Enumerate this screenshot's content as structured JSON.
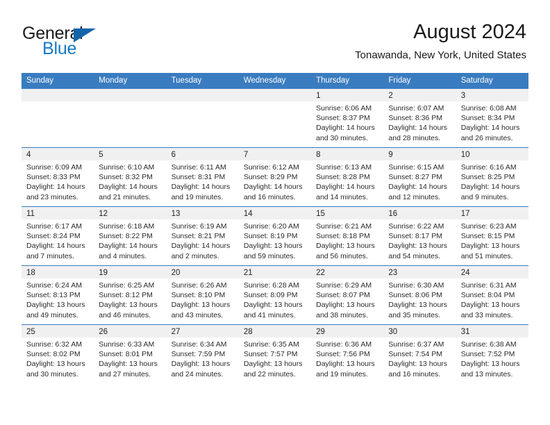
{
  "brand": {
    "line1": "General",
    "line2": "Blue",
    "triangle_color": "#1464aa",
    "blue_color": "#1579c4"
  },
  "header": {
    "title": "August 2024",
    "subtitle": "Tonawanda, New York, United States"
  },
  "theme": {
    "header_blue": "#3a7cc0",
    "daynum_band": "#f0f0f0",
    "text": "#2a2a2a"
  },
  "weekday_headers": [
    "Sunday",
    "Monday",
    "Tuesday",
    "Wednesday",
    "Thursday",
    "Friday",
    "Saturday"
  ],
  "weeks": [
    [
      {
        "day": "",
        "sunrise": "",
        "sunset": "",
        "daylight_line1": "",
        "daylight_line2": ""
      },
      {
        "day": "",
        "sunrise": "",
        "sunset": "",
        "daylight_line1": "",
        "daylight_line2": ""
      },
      {
        "day": "",
        "sunrise": "",
        "sunset": "",
        "daylight_line1": "",
        "daylight_line2": ""
      },
      {
        "day": "",
        "sunrise": "",
        "sunset": "",
        "daylight_line1": "",
        "daylight_line2": ""
      },
      {
        "day": "1",
        "sunrise": "Sunrise: 6:06 AM",
        "sunset": "Sunset: 8:37 PM",
        "daylight_line1": "Daylight: 14 hours",
        "daylight_line2": "and 30 minutes."
      },
      {
        "day": "2",
        "sunrise": "Sunrise: 6:07 AM",
        "sunset": "Sunset: 8:36 PM",
        "daylight_line1": "Daylight: 14 hours",
        "daylight_line2": "and 28 minutes."
      },
      {
        "day": "3",
        "sunrise": "Sunrise: 6:08 AM",
        "sunset": "Sunset: 8:34 PM",
        "daylight_line1": "Daylight: 14 hours",
        "daylight_line2": "and 26 minutes."
      }
    ],
    [
      {
        "day": "4",
        "sunrise": "Sunrise: 6:09 AM",
        "sunset": "Sunset: 8:33 PM",
        "daylight_line1": "Daylight: 14 hours",
        "daylight_line2": "and 23 minutes."
      },
      {
        "day": "5",
        "sunrise": "Sunrise: 6:10 AM",
        "sunset": "Sunset: 8:32 PM",
        "daylight_line1": "Daylight: 14 hours",
        "daylight_line2": "and 21 minutes."
      },
      {
        "day": "6",
        "sunrise": "Sunrise: 6:11 AM",
        "sunset": "Sunset: 8:31 PM",
        "daylight_line1": "Daylight: 14 hours",
        "daylight_line2": "and 19 minutes."
      },
      {
        "day": "7",
        "sunrise": "Sunrise: 6:12 AM",
        "sunset": "Sunset: 8:29 PM",
        "daylight_line1": "Daylight: 14 hours",
        "daylight_line2": "and 16 minutes."
      },
      {
        "day": "8",
        "sunrise": "Sunrise: 6:13 AM",
        "sunset": "Sunset: 8:28 PM",
        "daylight_line1": "Daylight: 14 hours",
        "daylight_line2": "and 14 minutes."
      },
      {
        "day": "9",
        "sunrise": "Sunrise: 6:15 AM",
        "sunset": "Sunset: 8:27 PM",
        "daylight_line1": "Daylight: 14 hours",
        "daylight_line2": "and 12 minutes."
      },
      {
        "day": "10",
        "sunrise": "Sunrise: 6:16 AM",
        "sunset": "Sunset: 8:25 PM",
        "daylight_line1": "Daylight: 14 hours",
        "daylight_line2": "and 9 minutes."
      }
    ],
    [
      {
        "day": "11",
        "sunrise": "Sunrise: 6:17 AM",
        "sunset": "Sunset: 8:24 PM",
        "daylight_line1": "Daylight: 14 hours",
        "daylight_line2": "and 7 minutes."
      },
      {
        "day": "12",
        "sunrise": "Sunrise: 6:18 AM",
        "sunset": "Sunset: 8:22 PM",
        "daylight_line1": "Daylight: 14 hours",
        "daylight_line2": "and 4 minutes."
      },
      {
        "day": "13",
        "sunrise": "Sunrise: 6:19 AM",
        "sunset": "Sunset: 8:21 PM",
        "daylight_line1": "Daylight: 14 hours",
        "daylight_line2": "and 2 minutes."
      },
      {
        "day": "14",
        "sunrise": "Sunrise: 6:20 AM",
        "sunset": "Sunset: 8:19 PM",
        "daylight_line1": "Daylight: 13 hours",
        "daylight_line2": "and 59 minutes."
      },
      {
        "day": "15",
        "sunrise": "Sunrise: 6:21 AM",
        "sunset": "Sunset: 8:18 PM",
        "daylight_line1": "Daylight: 13 hours",
        "daylight_line2": "and 56 minutes."
      },
      {
        "day": "16",
        "sunrise": "Sunrise: 6:22 AM",
        "sunset": "Sunset: 8:17 PM",
        "daylight_line1": "Daylight: 13 hours",
        "daylight_line2": "and 54 minutes."
      },
      {
        "day": "17",
        "sunrise": "Sunrise: 6:23 AM",
        "sunset": "Sunset: 8:15 PM",
        "daylight_line1": "Daylight: 13 hours",
        "daylight_line2": "and 51 minutes."
      }
    ],
    [
      {
        "day": "18",
        "sunrise": "Sunrise: 6:24 AM",
        "sunset": "Sunset: 8:13 PM",
        "daylight_line1": "Daylight: 13 hours",
        "daylight_line2": "and 49 minutes."
      },
      {
        "day": "19",
        "sunrise": "Sunrise: 6:25 AM",
        "sunset": "Sunset: 8:12 PM",
        "daylight_line1": "Daylight: 13 hours",
        "daylight_line2": "and 46 minutes."
      },
      {
        "day": "20",
        "sunrise": "Sunrise: 6:26 AM",
        "sunset": "Sunset: 8:10 PM",
        "daylight_line1": "Daylight: 13 hours",
        "daylight_line2": "and 43 minutes."
      },
      {
        "day": "21",
        "sunrise": "Sunrise: 6:28 AM",
        "sunset": "Sunset: 8:09 PM",
        "daylight_line1": "Daylight: 13 hours",
        "daylight_line2": "and 41 minutes."
      },
      {
        "day": "22",
        "sunrise": "Sunrise: 6:29 AM",
        "sunset": "Sunset: 8:07 PM",
        "daylight_line1": "Daylight: 13 hours",
        "daylight_line2": "and 38 minutes."
      },
      {
        "day": "23",
        "sunrise": "Sunrise: 6:30 AM",
        "sunset": "Sunset: 8:06 PM",
        "daylight_line1": "Daylight: 13 hours",
        "daylight_line2": "and 35 minutes."
      },
      {
        "day": "24",
        "sunrise": "Sunrise: 6:31 AM",
        "sunset": "Sunset: 8:04 PM",
        "daylight_line1": "Daylight: 13 hours",
        "daylight_line2": "and 33 minutes."
      }
    ],
    [
      {
        "day": "25",
        "sunrise": "Sunrise: 6:32 AM",
        "sunset": "Sunset: 8:02 PM",
        "daylight_line1": "Daylight: 13 hours",
        "daylight_line2": "and 30 minutes."
      },
      {
        "day": "26",
        "sunrise": "Sunrise: 6:33 AM",
        "sunset": "Sunset: 8:01 PM",
        "daylight_line1": "Daylight: 13 hours",
        "daylight_line2": "and 27 minutes."
      },
      {
        "day": "27",
        "sunrise": "Sunrise: 6:34 AM",
        "sunset": "Sunset: 7:59 PM",
        "daylight_line1": "Daylight: 13 hours",
        "daylight_line2": "and 24 minutes."
      },
      {
        "day": "28",
        "sunrise": "Sunrise: 6:35 AM",
        "sunset": "Sunset: 7:57 PM",
        "daylight_line1": "Daylight: 13 hours",
        "daylight_line2": "and 22 minutes."
      },
      {
        "day": "29",
        "sunrise": "Sunrise: 6:36 AM",
        "sunset": "Sunset: 7:56 PM",
        "daylight_line1": "Daylight: 13 hours",
        "daylight_line2": "and 19 minutes."
      },
      {
        "day": "30",
        "sunrise": "Sunrise: 6:37 AM",
        "sunset": "Sunset: 7:54 PM",
        "daylight_line1": "Daylight: 13 hours",
        "daylight_line2": "and 16 minutes."
      },
      {
        "day": "31",
        "sunrise": "Sunrise: 6:38 AM",
        "sunset": "Sunset: 7:52 PM",
        "daylight_line1": "Daylight: 13 hours",
        "daylight_line2": "and 13 minutes."
      }
    ]
  ]
}
